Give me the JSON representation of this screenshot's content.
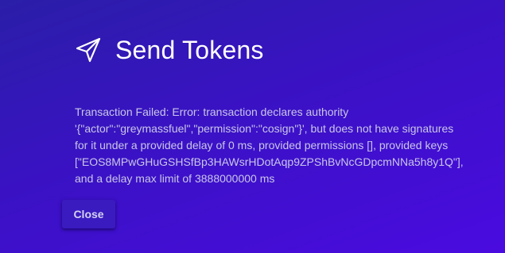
{
  "dialog": {
    "icon": "send-paper-plane-icon",
    "title": "Send Tokens",
    "message_lines": [
      "Transaction Failed: Error: transaction declares authority",
      "'{\"actor\":\"greymassfuel\",\"permission\":\"cosign\"}', but does not have signatures",
      "for it under a provided delay of 0 ms, provided permissions [], provided keys",
      "[\"EOS8MPwGHuGSHSfBp3HAWsrHDotAqp9ZPShBvNcGDpcmNNa5h8y1Q\"],",
      "and a delay max limit of 3888000000 ms"
    ],
    "close_label": "Close"
  },
  "colors": {
    "background_start": "#2a1ea8",
    "background_end": "#4a0be0",
    "title_text": "#ffffff",
    "message_text": "#c9c6e8"
  }
}
